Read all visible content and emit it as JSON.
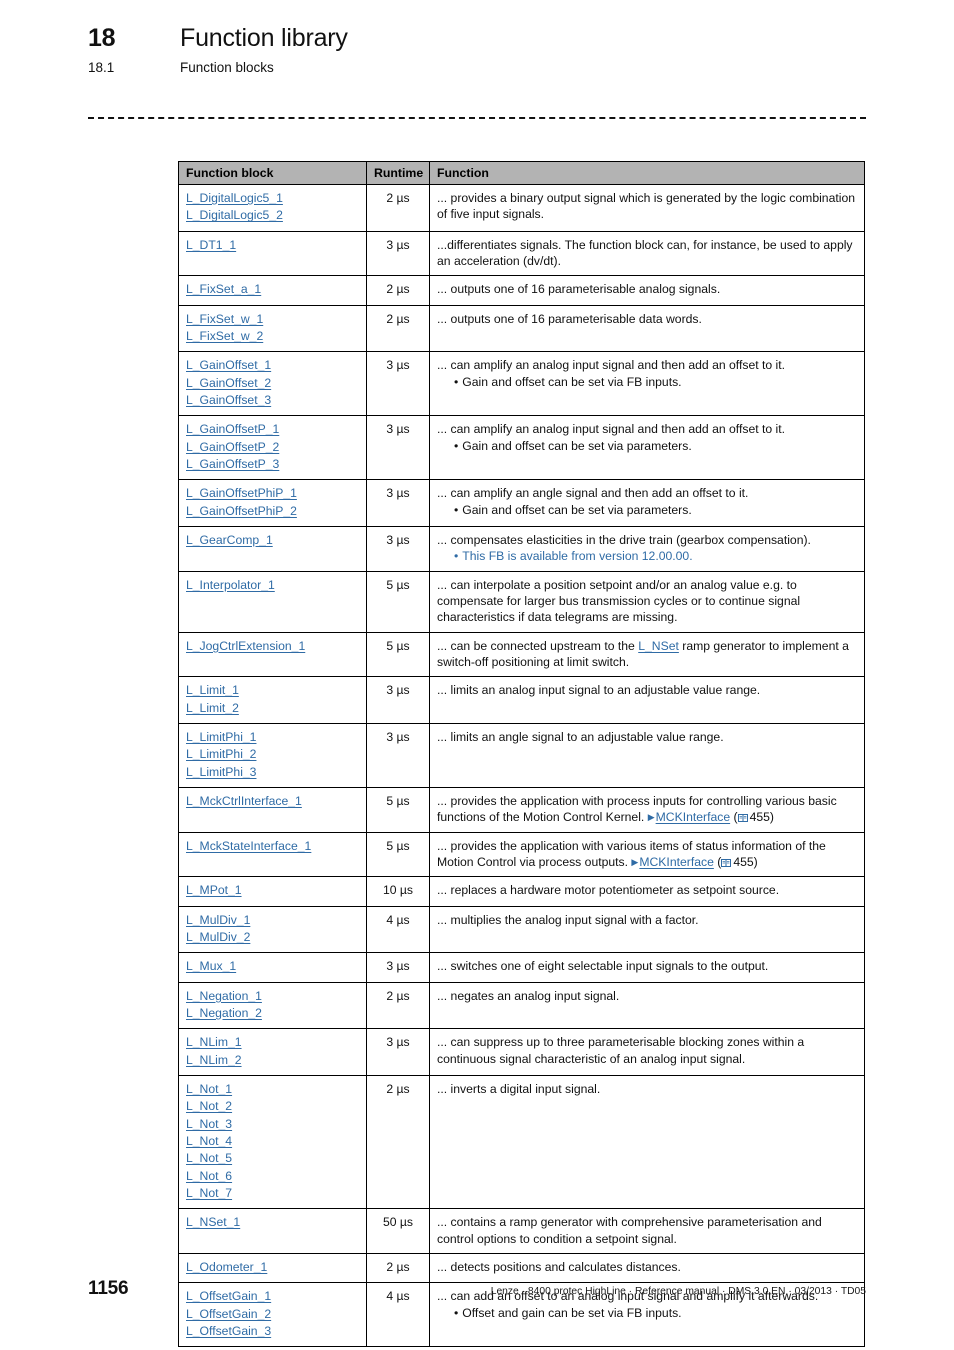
{
  "header": {
    "chapter_number": "18",
    "chapter_title": "Function library",
    "section_number": "18.1",
    "section_title": "Function blocks"
  },
  "table": {
    "columns": {
      "block": "Function block",
      "runtime": "Runtime",
      "function": "Function"
    },
    "rows": [
      {
        "blocks": [
          "L_DigitalLogic5_1",
          "L_DigitalLogic5_2"
        ],
        "runtime": "2 µs",
        "desc": "... provides a binary output signal which is generated by the logic combination of five input signals."
      },
      {
        "blocks": [
          "L_DT1_1"
        ],
        "runtime": "3 µs",
        "desc": "...differentiates signals. The function block can, for instance, be used to apply an acceleration (dv/dt)."
      },
      {
        "blocks": [
          "L_FixSet_a_1"
        ],
        "runtime": "2 µs",
        "desc": "... outputs one of 16 parameterisable analog signals."
      },
      {
        "blocks": [
          "L_FixSet_w_1",
          "L_FixSet_w_2"
        ],
        "runtime": "2 µs",
        "desc": "... outputs one of 16 parameterisable data words."
      },
      {
        "blocks": [
          "L_GainOffset_1",
          "L_GainOffset_2",
          "L_GainOffset_3"
        ],
        "runtime": "3 µs",
        "desc": "... can amplify an analog input signal and then add an offset to it.",
        "bullet": "Gain and offset can be set via FB inputs."
      },
      {
        "blocks": [
          "L_GainOffsetP_1",
          "L_GainOffsetP_2",
          "L_GainOffsetP_3"
        ],
        "runtime": "3 µs",
        "desc": "... can amplify an analog input signal and then add an offset to it.",
        "bullet": "Gain and offset can be set via parameters."
      },
      {
        "blocks": [
          "L_GainOffsetPhiP_1",
          "L_GainOffsetPhiP_2"
        ],
        "runtime": "3 µs",
        "desc": "... can amplify an angle signal and then add an offset to it.",
        "bullet": "Gain and offset can be set via parameters."
      },
      {
        "blocks": [
          "L_GearComp_1"
        ],
        "runtime": "3 µs",
        "desc": "... compensates elasticities in the drive train (gearbox compensation).",
        "bullet": "This FB is available from version 12.00.00.",
        "bullet_blue": true
      },
      {
        "blocks": [
          "L_Interpolator_1"
        ],
        "runtime": "5 µs",
        "desc": "... can interpolate a position setpoint and/or an analog value e.g. to compensate for larger bus transmission cycles or to continue signal characteristics if data telegrams are missing."
      },
      {
        "blocks": [
          "L_JogCtrlExtension_1"
        ],
        "runtime": "5 µs",
        "desc_pre": "... can be connected upstream to the ",
        "inline_link": "L_NSet",
        "desc_post": " ramp generator to implement a switch-off positioning at limit switch."
      },
      {
        "blocks": [
          "L_Limit_1",
          "L_Limit_2"
        ],
        "runtime": "3 µs",
        "desc": "... limits an analog input signal to an adjustable value range."
      },
      {
        "blocks": [
          "L_LimitPhi_1",
          "L_LimitPhi_2",
          "L_LimitPhi_3"
        ],
        "runtime": "3 µs",
        "desc": "... limits an angle signal to an adjustable value range."
      },
      {
        "blocks": [
          "L_MckCtrlInterface_1"
        ],
        "runtime": "5 µs",
        "desc_pre": "... provides the application with process inputs for controlling various basic functions of the Motion Control Kernel. ",
        "xref_label": "MCKInterface",
        "xref_page": "455"
      },
      {
        "blocks": [
          "L_MckStateInterface_1"
        ],
        "runtime": "5 µs",
        "desc_pre": "... provides the application with various items of status information of the Motion Control via process outputs. ",
        "xref_label": "MCKInterface",
        "xref_page": "455"
      },
      {
        "blocks": [
          "L_MPot_1"
        ],
        "runtime": "10 µs",
        "desc": "... replaces a hardware motor potentiometer as setpoint source."
      },
      {
        "blocks": [
          "L_MulDiv_1",
          "L_MulDiv_2"
        ],
        "runtime": "4 µs",
        "desc": "... multiplies the analog input signal with a factor."
      },
      {
        "blocks": [
          "L_Mux_1"
        ],
        "runtime": "3 µs",
        "desc": "... switches one of eight selectable input signals to the output."
      },
      {
        "blocks": [
          "L_Negation_1",
          "L_Negation_2"
        ],
        "runtime": "2 µs",
        "desc": "... negates an analog input signal."
      },
      {
        "blocks": [
          "L_NLim_1",
          "L_NLim_2"
        ],
        "runtime": "3 µs",
        "desc": "... can suppress up to three parameterisable blocking zones within a continuous signal characteristic of an analog input signal."
      },
      {
        "blocks": [
          "L_Not_1",
          "L_Not_2",
          "L_Not_3",
          "L_Not_4",
          "L_Not_5",
          "L_Not_6",
          "L_Not_7"
        ],
        "runtime": "2 µs",
        "desc": "... inverts a digital input signal."
      },
      {
        "blocks": [
          "L_NSet_1"
        ],
        "runtime": "50 µs",
        "desc": "... contains a ramp generator with comprehensive parameterisation and control options to condition a setpoint signal."
      },
      {
        "blocks": [
          "L_Odometer_1"
        ],
        "runtime": "2 µs",
        "desc": "... detects positions and calculates distances."
      },
      {
        "blocks": [
          "L_OffsetGain_1",
          "L_OffsetGain_2",
          "L_OffsetGain_3"
        ],
        "runtime": "4 µs",
        "desc": "... can add an offset to an analog input signal and amplify it afterwards.",
        "bullet": "Offset and gain can be set via FB inputs."
      }
    ]
  },
  "footer": {
    "page_number": "1156",
    "meta": "Lenze · 8400 protec HighLine · Reference manual · DMS 3.0 EN · 03/2013 · TD05"
  },
  "colors": {
    "link": "#2f6ba5",
    "header_bg": "#b3b3b3",
    "text": "#111111"
  }
}
